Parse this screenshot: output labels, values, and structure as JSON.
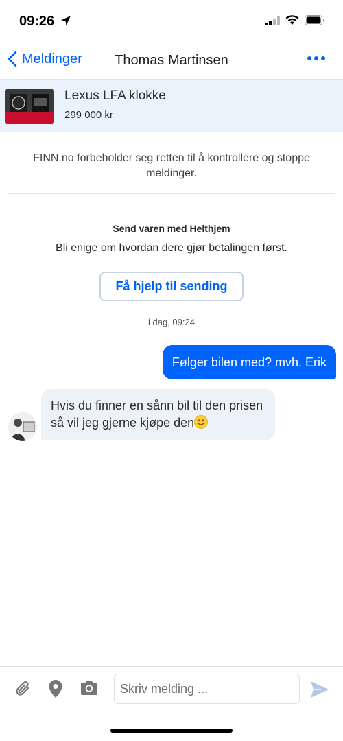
{
  "status_bar": {
    "time": "09:26",
    "icons": [
      "location-arrow-icon",
      "cellular-signal-icon",
      "wifi-icon",
      "battery-icon"
    ]
  },
  "nav": {
    "back_label": "Meldinger",
    "title": "Thomas Martinsen",
    "more_icon": "more-dots-icon"
  },
  "ad": {
    "title": "Lexus LFA klokke",
    "price": "299 000 kr"
  },
  "disclaimer": "FINN.no forbeholder seg retten til å kontrollere og stoppe meldinger.",
  "shipping": {
    "title": "Send varen med Helthjem",
    "text": "Bli enige om hvordan dere gjør betalingen først.",
    "button_label": "Få hjelp til sending"
  },
  "conversation": {
    "timestamp": "i dag, 09:24",
    "messages": [
      {
        "direction": "outgoing",
        "text": "Følger bilen med? mvh. Erik"
      },
      {
        "direction": "incoming",
        "text": "Hvis du finner en sånn bil til den prisen så vil jeg gjerne kjøpe den",
        "emoji": "smiling-face-icon"
      }
    ]
  },
  "composer": {
    "placeholder": "Skriv melding ...",
    "value": "",
    "icons": [
      "paperclip-icon",
      "location-pin-icon",
      "camera-icon",
      "send-icon"
    ]
  },
  "colors": {
    "accent": "#0063fb",
    "ad_background": "#eaf3fc",
    "incoming_bubble": "#edf1f8"
  }
}
